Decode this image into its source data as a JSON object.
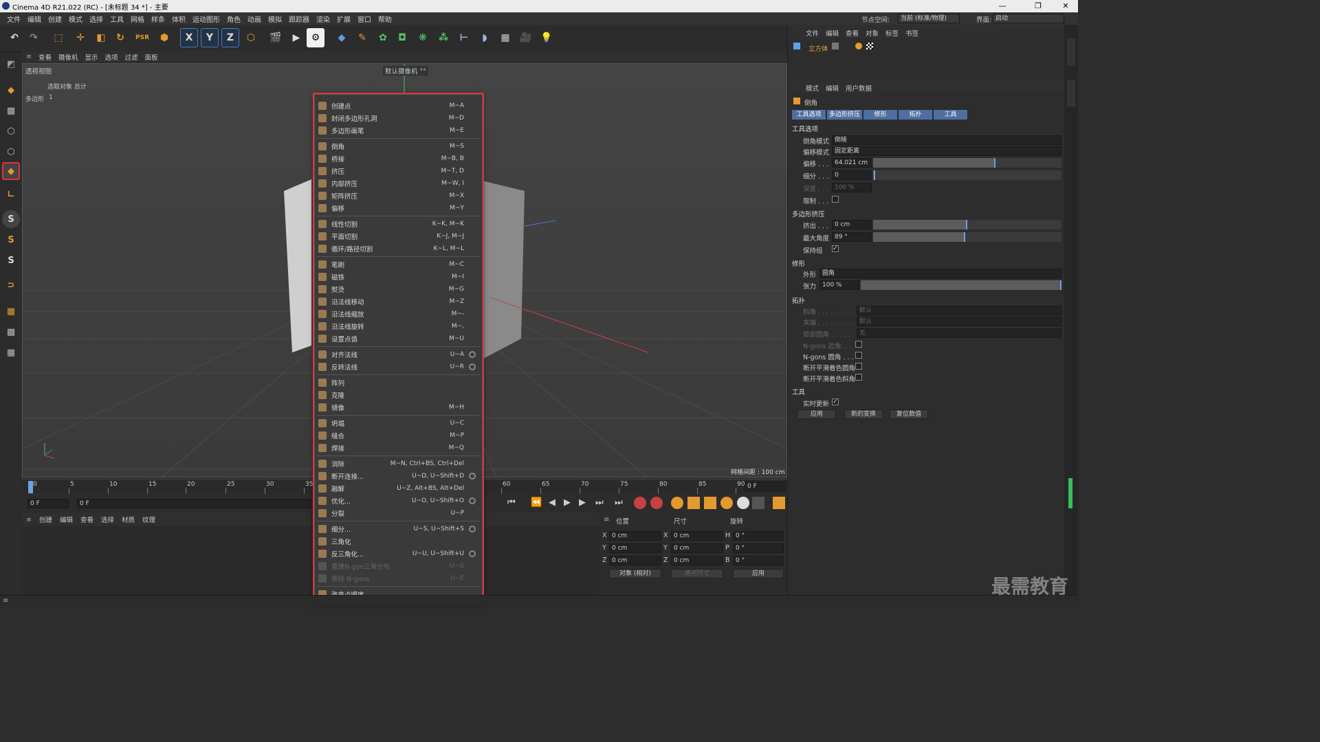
{
  "app": {
    "title": "Cinema 4D R21.022 (RC) - [未标题 34 *] - 主要"
  },
  "menubar": [
    "文件",
    "编辑",
    "创建",
    "模式",
    "选择",
    "工具",
    "网格",
    "样条",
    "体积",
    "运动图形",
    "角色",
    "动画",
    "模拟",
    "跟踪器",
    "渲染",
    "扩展",
    "窗口",
    "帮助"
  ],
  "topright": {
    "node_label": "节点空间:",
    "node_value": "当前 (标准/物理)",
    "layout_label": "界面:",
    "layout_value": "启动"
  },
  "viewport": {
    "menu": [
      "查看",
      "摄像机",
      "显示",
      "选项",
      "过滤",
      "面板"
    ],
    "name": "透视视图",
    "camera": "默认摄像机 °°",
    "stats_header": "选取对象 总计",
    "stats_label": "多边形",
    "stats_value": "1",
    "grid": "网格间距 : 100 cm"
  },
  "timeline": {
    "ticks": [
      "0",
      "5",
      "10",
      "15",
      "20",
      "25",
      "30",
      "35",
      "60",
      "65",
      "70",
      "75",
      "80",
      "85",
      "90"
    ],
    "frame_end": "0 F",
    "frame_left": "0 F",
    "frame_left2": "0 F"
  },
  "material": {
    "menu": [
      "创建",
      "编辑",
      "查看",
      "选择",
      "材质",
      "纹理"
    ]
  },
  "coords": {
    "headers": [
      "位置",
      "尺寸",
      "旋转"
    ],
    "rows": [
      {
        "a": "X",
        "av": "0 cm",
        "b": "X",
        "bv": "0 cm",
        "c": "H",
        "cv": "0 °"
      },
      {
        "a": "Y",
        "av": "0 cm",
        "b": "Y",
        "bv": "0 cm",
        "c": "P",
        "cv": "0 °"
      },
      {
        "a": "Z",
        "av": "0 cm",
        "b": "Z",
        "bv": "0 cm",
        "c": "B",
        "cv": "0 °"
      }
    ],
    "mode": "对象 (相对)",
    "size_mode": "绝对尺寸",
    "apply": "应用"
  },
  "objmgr": {
    "menu": [
      "文件",
      "编辑",
      "查看",
      "对象",
      "标签",
      "书签"
    ],
    "object": "立方体"
  },
  "attr": {
    "menu": [
      "模式",
      "编辑",
      "用户数据"
    ],
    "tool": "倒角",
    "tabs": [
      "工具选项",
      "多边形挤压",
      "修形",
      "拓扑",
      "工具"
    ],
    "sec_tool": "工具选项",
    "bevel_mode_label": "倒角模式",
    "bevel_mode": "倒棱",
    "offset_mode_label": "偏移模式",
    "offset_mode": "固定距离",
    "offset_label": "偏移 . . .",
    "offset": "64.021 cm",
    "sub_label": "细分 . . .",
    "sub": "0",
    "depth_label": "深度 . . .",
    "depth": "100 %",
    "limit_label": "限制 . . .",
    "sec_ext": "多边形挤压",
    "extrude_label": "挤出 . . .",
    "extrude": "0 cm",
    "maxangle_label": "最大角度",
    "maxangle": "89 °",
    "keepgroup_label": "保持组",
    "sec_shape": "修形",
    "shape_label": "外形",
    "shape": "圆角",
    "tension_label": "张力",
    "tension": "100 %",
    "sec_topo": "拓扑",
    "corner_label": "斜角 . . . . . . . . .",
    "corner": "默认",
    "end_label": "末端 . . . . . . . . .",
    "end": "默认",
    "partial_label": "局部圆角 . . . . . .",
    "partial": "无",
    "ngon_corner": "N-gons 边角. . .",
    "ngon_round": "N-gons 圆角 . . .",
    "phong_round": "断开平滑着色圆角",
    "phong_bevel": "断开平滑着色斜角",
    "sec_tools": "工具",
    "realtime": "实时更新",
    "btn_apply": "应用",
    "btn_new": "新的变换",
    "btn_reset": "复位数值"
  },
  "contextmenu": [
    {
      "label": "创建点",
      "sc": "M~A"
    },
    {
      "label": "封闭多边形孔洞",
      "sc": "M~D"
    },
    {
      "label": "多边形画笔",
      "sc": "M~E"
    },
    {
      "sep": true
    },
    {
      "label": "倒角",
      "sc": "M~S"
    },
    {
      "label": "桥接",
      "sc": "M~B, B"
    },
    {
      "label": "挤压",
      "sc": "M~T, D"
    },
    {
      "label": "内部挤压",
      "sc": "M~W, I"
    },
    {
      "label": "矩阵挤压",
      "sc": "M~X"
    },
    {
      "label": "偏移",
      "sc": "M~Y"
    },
    {
      "sep": true
    },
    {
      "label": "线性切割",
      "sc": "K~K, M~K"
    },
    {
      "label": "平面切割",
      "sc": "K~J, M~J"
    },
    {
      "label": "循环/路径切割",
      "sc": "K~L, M~L"
    },
    {
      "sep": true
    },
    {
      "label": "笔刷",
      "sc": "M~C"
    },
    {
      "label": "磁铁",
      "sc": "M~I"
    },
    {
      "label": "熨烫",
      "sc": "M~G"
    },
    {
      "label": "沿法线移动",
      "sc": "M~Z"
    },
    {
      "label": "沿法线缩放",
      "sc": "M~-"
    },
    {
      "label": "沿法线旋转",
      "sc": "M~,"
    },
    {
      "label": "设置点值",
      "sc": "M~U"
    },
    {
      "sep": true
    },
    {
      "label": "对齐法线",
      "sc": "U~A",
      "gear": true
    },
    {
      "label": "反转法线",
      "sc": "U~R",
      "gear": true
    },
    {
      "sep": true
    },
    {
      "label": "阵列",
      "sc": ""
    },
    {
      "label": "克隆",
      "sc": ""
    },
    {
      "label": "镜像",
      "sc": "M~H"
    },
    {
      "sep": true
    },
    {
      "label": "坍塌",
      "sc": "U~C"
    },
    {
      "label": "缝合",
      "sc": "M~P"
    },
    {
      "label": "焊接",
      "sc": "M~Q"
    },
    {
      "sep": true
    },
    {
      "label": "消除",
      "sc": "M~N, Ctrl+BS, Ctrl+Del"
    },
    {
      "label": "断开连接...",
      "sc": "U~D, U~Shift+D",
      "gear": true
    },
    {
      "label": "融解",
      "sc": "U~Z, Alt+BS, Alt+Del"
    },
    {
      "label": "优化...",
      "sc": "U~O, U~Shift+O",
      "gear": true
    },
    {
      "label": "分裂",
      "sc": "U~P"
    },
    {
      "sep": true
    },
    {
      "label": "细分...",
      "sc": "U~S, U~Shift+S",
      "gear": true
    },
    {
      "label": "三角化",
      "sc": ""
    },
    {
      "label": "反三角化...",
      "sc": "U~U, U~Shift+U",
      "gear": true
    },
    {
      "label": "重建N-gon三角分布",
      "sc": "U~G",
      "dis": true
    },
    {
      "label": "移除 N-gons",
      "sc": "U~E",
      "dis": true
    },
    {
      "sep": true
    },
    {
      "label": "改变点顺序",
      "sc": ""
    }
  ],
  "watermark": "最需教育"
}
